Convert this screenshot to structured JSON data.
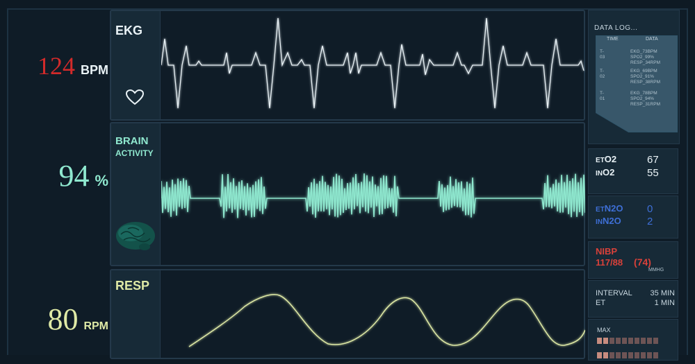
{
  "readouts": {
    "heart_rate": {
      "value": "124",
      "unit": "BPM"
    },
    "brain": {
      "value": "94",
      "unit": "%"
    },
    "resp": {
      "value": "80",
      "unit": "RPM"
    }
  },
  "channels": {
    "ekg": {
      "label": "EKG",
      "color": "#e9f2f6"
    },
    "brain": {
      "label_line1": "BRAIN",
      "label_line2": "ACTIVITY",
      "color": "#8fe8cf"
    },
    "resp": {
      "label": "RESP",
      "color": "#dfeaa6"
    }
  },
  "icons": {
    "heart": "heart-outline-icon",
    "brain": "brain-3d-icon"
  },
  "data_log": {
    "title": "DATA LOG...",
    "col_time": "TIME",
    "col_data": "DATA",
    "rows": [
      {
        "time": "T-03",
        "lines": [
          "EKG_73BPM",
          "SPO2_99%",
          "RESP_34RPM"
        ]
      },
      {
        "time": "T-02",
        "lines": [
          "EKG_69BPM",
          "SPO2_91%",
          "RESP_38RPM"
        ]
      },
      {
        "time": "T-01",
        "lines": [
          "EKG_78BPM",
          "SPO2_94%",
          "RESP_31RPM"
        ]
      }
    ]
  },
  "gases": [
    {
      "prefix": "ET",
      "name": "O2",
      "value": "67",
      "color": "#e9f2f6"
    },
    {
      "prefix": "IN",
      "name": "O2",
      "value": "55",
      "color": "#e9f2f6"
    },
    {
      "prefix": "ET",
      "name": "N2O",
      "value": "0",
      "color": "#3e6fd6"
    },
    {
      "prefix": "IN",
      "name": "N2O",
      "value": "2",
      "color": "#3e6fd6"
    }
  ],
  "nibp": {
    "label": "NIBP",
    "value": "117/88",
    "mean": "(74)",
    "unit": "MMHG",
    "color": "#d9413a"
  },
  "interval": {
    "interval_label": "INTERVAL",
    "interval_value": "35 MIN",
    "et_label": "ET",
    "et_value": "1 MIN"
  },
  "max_meter": {
    "label": "MAX",
    "segments": 10,
    "lit": 2
  }
}
